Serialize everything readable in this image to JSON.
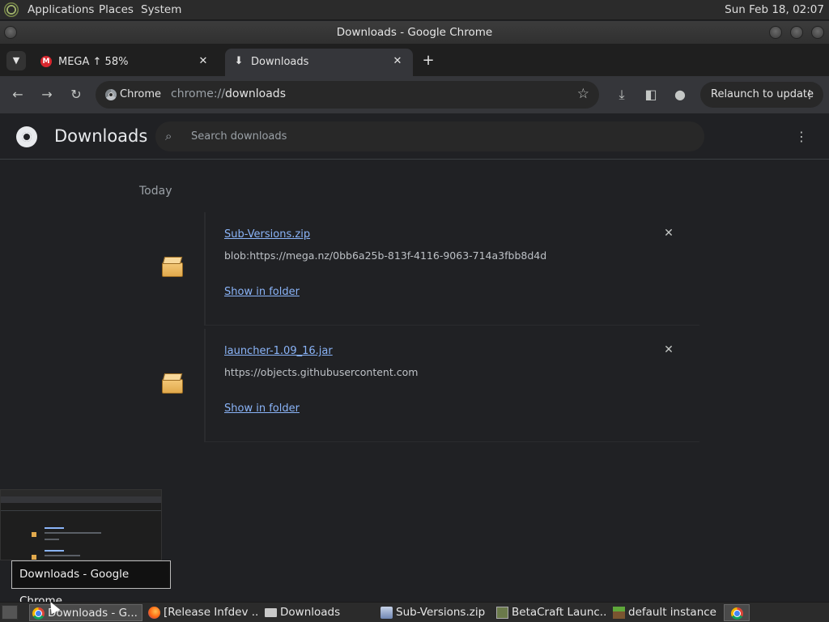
{
  "top_panel": {
    "menus": [
      "Applications",
      "Places",
      "System"
    ],
    "clock": "Sun Feb 18, 02:07"
  },
  "window": {
    "title": "Downloads - Google Chrome"
  },
  "tabs": [
    {
      "label": "MEGA ↑ 58%",
      "icon": "mega-icon",
      "active": false
    },
    {
      "label": "Downloads",
      "icon": "download-icon",
      "active": true
    }
  ],
  "toolbar": {
    "chip_label": "Chrome",
    "url_scheme": "chrome://",
    "url_host": "downloads",
    "relaunch_label": "Relaunch to update"
  },
  "downloads_page": {
    "title": "Downloads",
    "search_placeholder": "Search downloads",
    "section_label": "Today",
    "items": [
      {
        "file_name": "Sub-Versions.zip",
        "source_url": "blob:https://mega.nz/0bb6a25b-813f-4116-9063-714a3fbb8d4d",
        "action_label": "Show in folder"
      },
      {
        "file_name": "launcher-1.09_16.jar",
        "source_url": "https://objects.githubusercontent.com",
        "action_label": "Show in folder"
      }
    ]
  },
  "tooltip": "Downloads - Google Chrome",
  "taskbar": {
    "tasks": [
      {
        "label": "Downloads - G...",
        "icon": "chrome-icon",
        "active": true
      },
      {
        "label": "[Release Infdev ...",
        "icon": "firefox-icon",
        "active": false
      },
      {
        "label": "Downloads",
        "icon": "folder-icon",
        "active": false
      },
      {
        "label": "Sub-Versions.zip",
        "icon": "archive-icon",
        "active": false
      },
      {
        "label": "BetaCraft Launc...",
        "icon": "betacraft-icon",
        "active": false
      },
      {
        "label": "default instance",
        "icon": "grass-block-icon",
        "active": false
      }
    ]
  }
}
